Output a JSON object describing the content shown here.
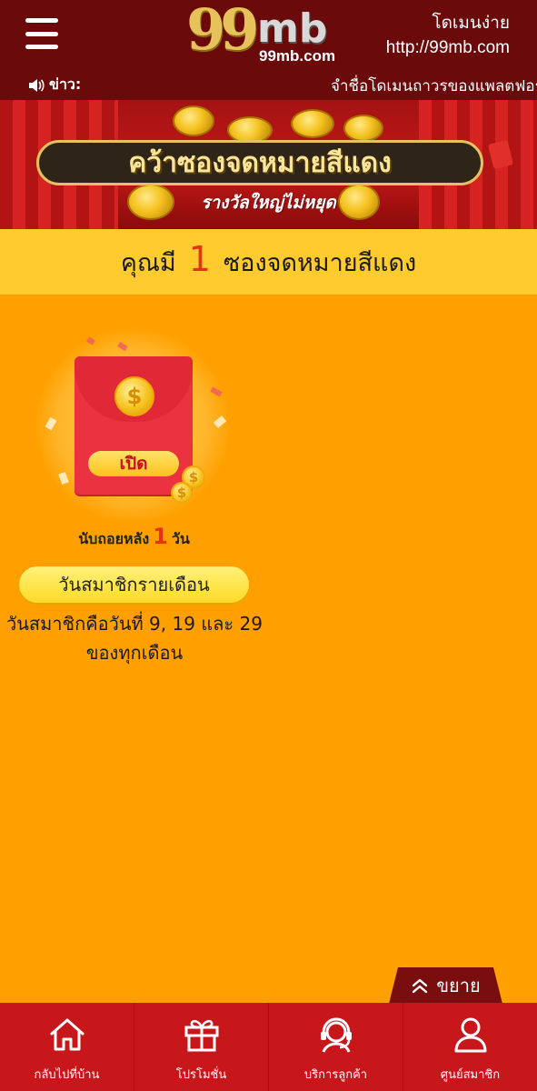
{
  "header": {
    "logo_main": "99",
    "logo_mb": "mb",
    "logo_sub": "99mb.com",
    "domain_label": "โดเมนง่าย",
    "domain_url": "http://99mb.com",
    "news_label": "ข่าว:",
    "news_ticker": "จำชื่อโดเมนถาวรของแพลตฟอร์ม"
  },
  "banner": {
    "title": "คว้าซองจดหมายสีแดง",
    "subtitle": "รางวัลใหญ่ไม่หยุด"
  },
  "count_bar": {
    "prefix": "คุณมี",
    "count": "1",
    "suffix": "ซองจดหมายสีแดง"
  },
  "envelope": {
    "coin_symbol": "$",
    "open_label": "เปิด",
    "countdown_prefix": "นับถอยหลัง",
    "countdown_value": "1",
    "countdown_unit": "วัน"
  },
  "member_day": {
    "button_label": "วันสมาชิกรายเดือน",
    "desc_line1": "วันสมาชิกคือวันที่ 9, 19 และ 29",
    "desc_line2": "ของทุกเดือน"
  },
  "expand": {
    "label": "ขยาย"
  },
  "bottom_nav": {
    "home": "กลับไปที่บ้าน",
    "promo": "โปรโมชั่น",
    "support": "บริการลูกค้า",
    "member": "ศูนย์สมาชิก"
  },
  "colors": {
    "header_bg": "#6B0A0A",
    "page_bg": "#FFA000",
    "count_bar_bg": "#FFCB2F",
    "accent_red": "#E63118",
    "nav_bg": "#C8171A"
  },
  "icons": {
    "menu": "hamburger-menu-icon",
    "speaker": "speaker-icon",
    "megaphone": "megaphone-icon",
    "home": "home-icon",
    "gift": "gift-icon",
    "headset": "headset-icon",
    "user": "user-icon",
    "chevron_up": "double-chevron-up-icon"
  }
}
